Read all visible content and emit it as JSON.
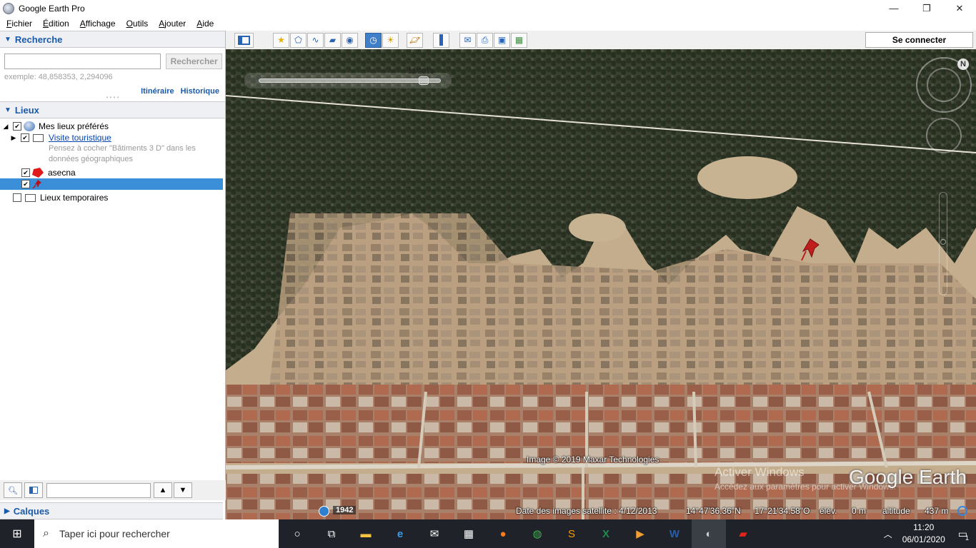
{
  "window": {
    "title": "Google Earth Pro",
    "minimize": "—",
    "maximize": "❐",
    "close": "✕"
  },
  "menu": [
    "Fichier",
    "Édition",
    "Affichage",
    "Outils",
    "Ajouter",
    "Aide"
  ],
  "search_panel": {
    "header": "Recherche",
    "input_value": "",
    "button": "Rechercher",
    "hint": "exemple: 48,858353, 2,294096",
    "links": [
      "Itinéraire",
      "Historique"
    ]
  },
  "places_panel": {
    "header": "Lieux",
    "items": [
      {
        "label": "Mes lieux préférés",
        "checked": true
      },
      {
        "label": "Visite touristique",
        "checked": true
      },
      {
        "label": "Pensez à cocher \"Bâtiments 3 D\" dans les données géographiques"
      },
      {
        "label": "asecna",
        "checked": true
      },
      {
        "label": "",
        "checked": true
      },
      {
        "label": "Lieux temporaires",
        "checked": false
      }
    ]
  },
  "layers_panel": {
    "header": "Calques"
  },
  "toolbar": {
    "icons": [
      "sidebar-icon",
      "placemark-icon",
      "polygon-icon",
      "path-icon",
      "image-overlay-icon",
      "record-tour-icon",
      "historical-imagery-icon",
      "sunlight-icon",
      "planets-icon",
      "ruler-icon",
      "email-icon",
      "print-icon",
      "save-image-icon",
      "view-in-maps-icon"
    ],
    "connect": "Se connecter"
  },
  "map": {
    "time_slider": "12/2013",
    "copyright": "Image © 2019 Maxar Technologies",
    "watermark_line1": "Activer Windows",
    "watermark_line2": "Accédez aux paramètres pour activer Windows.",
    "logo": "Google Earth",
    "status": {
      "year": "1942",
      "date": "Date des images satellite : 4/12/2013",
      "lat": "14°47'36.36\"N",
      "lon": "17°21'34.58\"O",
      "elev_label": "élév.",
      "elev_value": "0 m",
      "alt_label": "altitude",
      "alt_value": "437 m"
    }
  },
  "taskbar": {
    "search": "Taper ici pour rechercher",
    "time": "11:20",
    "date": "06/01/2020",
    "notifications": "1"
  }
}
